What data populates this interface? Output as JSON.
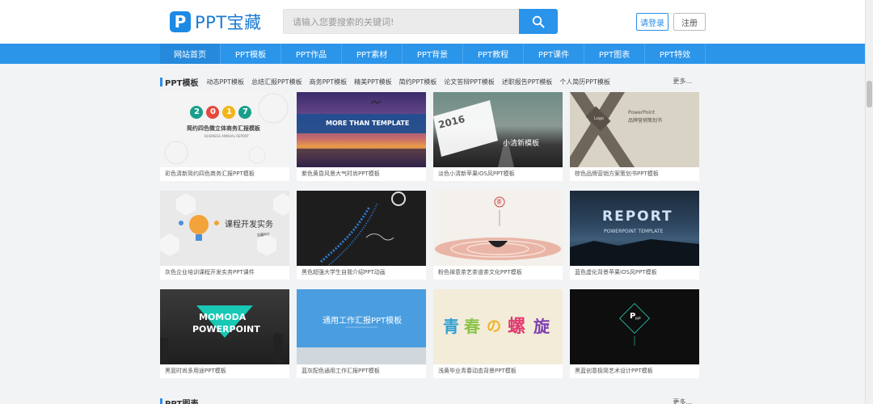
{
  "header": {
    "logo_mark": "P",
    "logo_text": "PPT宝藏",
    "search_placeholder": "请输入您要搜索的关键词!",
    "login_label": "请登录",
    "register_label": "注册"
  },
  "nav": {
    "items": [
      "网站首页",
      "PPT模板",
      "PPT作品",
      "PPT素材",
      "PPT背景",
      "PPT教程",
      "PPT课件",
      "PPT图表",
      "PPT特效"
    ]
  },
  "section": {
    "title": "PPT模板",
    "categories": [
      "动态PPT模板",
      "总结汇报PPT模板",
      "商务PPT模板",
      "精美PPT模板",
      "简约PPT模板",
      "论文答辩PPT模板",
      "述职报告PPT模板",
      "个人简历PPT模板"
    ],
    "more": "更多..."
  },
  "cards": [
    {
      "caption": "彩色清新简约四色商务汇报PPT模板",
      "thumb_text": [
        "2",
        "0",
        "1",
        "7",
        "简约四色微立体商务汇报模板",
        "BUSINESS ANNUAL REPORT"
      ]
    },
    {
      "caption": "紫色黄昏风景大气时尚PPT模板",
      "thumb_text": [
        "MORE THAN TEMPLATE"
      ]
    },
    {
      "caption": "淡色小清新苹果iOS风PPT模板",
      "thumb_text": [
        "2016",
        "小清新模板"
      ]
    },
    {
      "caption": "棕色品牌营销方案策划书PPT模板",
      "thumb_text": [
        "PowerPoint",
        "品牌营销策划书",
        "Logo"
      ]
    },
    {
      "caption": "灰色企业培训课程开发实务PPT课件",
      "thumb_text": [
        "课程开发实务",
        "宝藏PPT"
      ]
    },
    {
      "caption": "黑色超强大学生自我介绍PPT动画",
      "thumb_text": []
    },
    {
      "caption": "粉色禅意茶艺茶道茶文化PPT模板",
      "thumb_text": [
        "茶"
      ]
    },
    {
      "caption": "蓝色虚化背景苹果iOS风PPT模板",
      "thumb_text": [
        "REPORT",
        "POWERPOINT TEMPLATE"
      ]
    },
    {
      "caption": "黑篮时尚多用途PPT模板",
      "thumb_text": [
        "MOMODA",
        "POWERPOINT"
      ]
    },
    {
      "caption": "蓝灰配色通用工作汇报PPT模板",
      "thumb_text": [
        "通用工作汇报PPT模板"
      ]
    },
    {
      "caption": "浅黄毕业青春动态背景PPT模板",
      "thumb_text": [
        "青",
        "春",
        "の",
        "螺",
        "旋"
      ]
    },
    {
      "caption": "黑蓝创意极简艺术设计PPT模板",
      "thumb_text": [
        "P",
        "ppt"
      ]
    }
  ],
  "section2": {
    "title": "PPT图表",
    "more": "更多..."
  },
  "colors": {
    "brand": "#1c89e4",
    "nav": "#2b95ea",
    "page_bg": "#f2f3f5"
  }
}
